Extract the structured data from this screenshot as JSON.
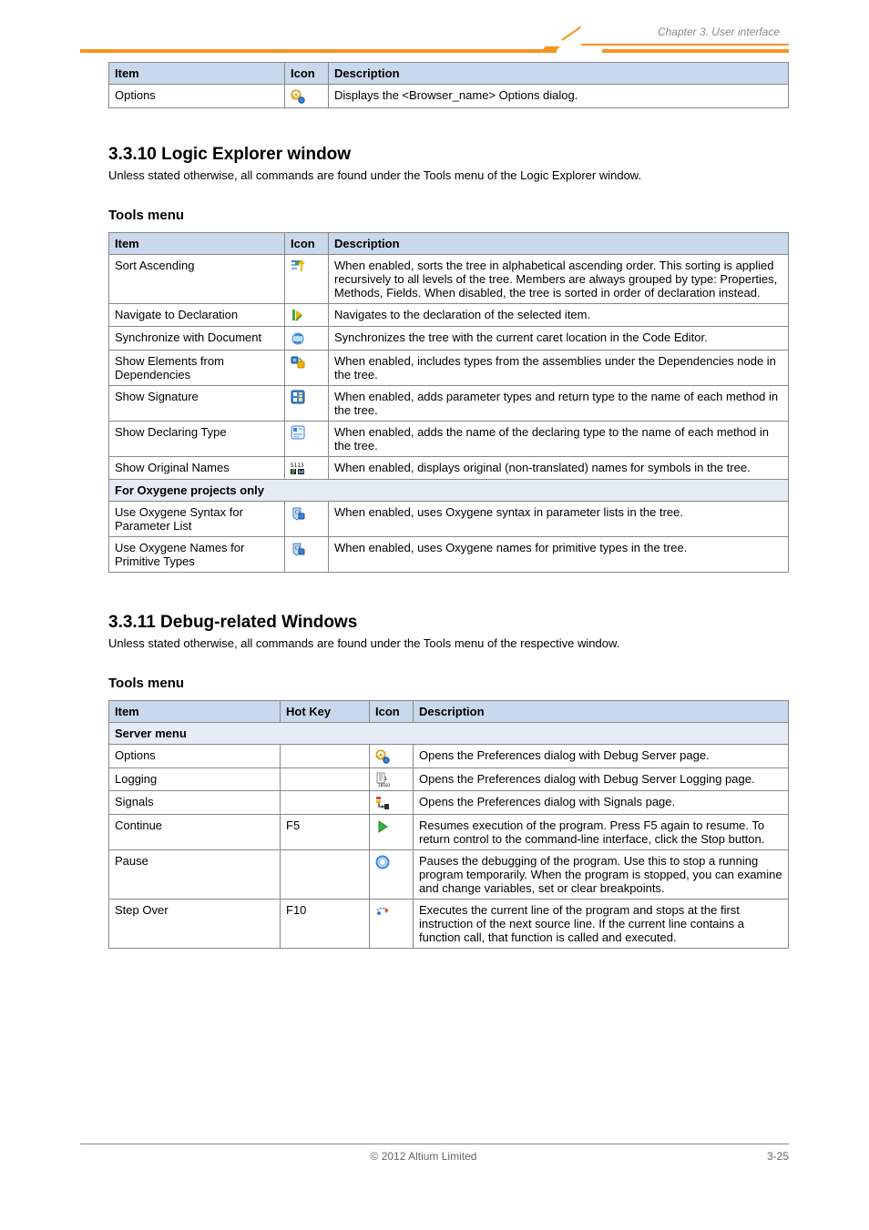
{
  "header_running": "Chapter 3. User interface",
  "footer": {
    "center": "© 2012 Altium Limited",
    "right": "3-25"
  },
  "table1": {
    "headers": [
      "Item",
      "Icon",
      "Description"
    ],
    "rows": [
      {
        "item": "Options",
        "icon": "options",
        "desc": "Displays the <Browser_name> Options dialog."
      }
    ]
  },
  "sections": {
    "logic_explorer": {
      "title": "3.3.10 Logic Explorer window",
      "sub": "Unless stated otherwise, all commands are found under the Tools menu of the Logic Explorer window.",
      "h2": "Tools menu"
    },
    "debug": {
      "title": "3.3.11 Debug-related Windows",
      "sub": "Unless stated otherwise, all commands are found under the Tools menu of the respective window.",
      "h2": "Tools menu"
    }
  },
  "table2": {
    "headers": [
      "Item",
      "Icon",
      "Description"
    ],
    "rows": [
      {
        "item": "Sort Ascending",
        "icon": "sort",
        "desc": "When enabled, sorts the tree in alphabetical ascending order. This sorting is applied recursively to all levels of the tree. Members are always grouped by type: Properties, Methods, Fields. When disabled, the tree is sorted in order of declaration instead."
      },
      {
        "item": "Navigate to Declaration",
        "icon": "nav-decl",
        "desc": "Navigates to the declaration of the selected item."
      },
      {
        "item": "Synchronize with Document",
        "icon": "sync",
        "desc": "Synchronizes the tree with the current caret location in the Code Editor."
      },
      {
        "item": "Show Elements from Dependencies",
        "icon": "deps",
        "desc": "When enabled, includes types from the assemblies under the Dependencies node in the tree."
      },
      {
        "item": "Show Signature",
        "icon": "sig",
        "desc": "When enabled, adds parameter types and return type to the name of each method in the tree."
      },
      {
        "item": "Show Declaring Type",
        "icon": "decl-type",
        "desc": "When enabled, adds the name of the declaring type to the name of each method in the tree."
      },
      {
        "item": "Show Original Names",
        "icon": "orig",
        "desc": "When enabled, displays original (non-translated) names for symbols in the tree."
      }
    ],
    "group": "For Oxygene projects only",
    "rows2": [
      {
        "item": "Use Oxygene Syntax for Parameter List",
        "icon": "oxy-param",
        "desc": "When enabled, uses Oxygene syntax in parameter lists in the tree."
      },
      {
        "item": "Use Oxygene Names for Primitive Types",
        "icon": "oxy-prim",
        "desc": "When enabled, uses Oxygene names for primitive types in the tree."
      }
    ]
  },
  "table3": {
    "headers": [
      "Item",
      "Hot Key",
      "Icon",
      "Description"
    ],
    "group": "Server menu",
    "rows": [
      {
        "item": "Options",
        "hotkey": "",
        "icon": "options",
        "desc": "Opens the Preferences dialog with Debug Server page."
      },
      {
        "item": "Logging",
        "hotkey": "",
        "icon": "logging",
        "desc": "Opens the Preferences dialog with Debug Server Logging page."
      },
      {
        "item": "Signals",
        "hotkey": "",
        "icon": "signals",
        "desc": "Opens the Preferences dialog with Signals page."
      },
      {
        "item": "Continue",
        "hotkey": "F5",
        "icon": "continue",
        "desc": "Resumes execution of the program. Press F5 again to resume. To return control to the command-line interface, click the Stop button."
      },
      {
        "item": "Pause",
        "hotkey": "",
        "icon": "pause",
        "desc": "Pauses the debugging of the program. Use this to stop a running program temporarily. When the program is stopped, you can examine and change variables, set or clear breakpoints."
      },
      {
        "item": "Step Over",
        "hotkey": "F10",
        "icon": "step-over",
        "desc": "Executes the current line of the program and stops at the first instruction of the next source line. If the current line contains a function call, that function is called and executed."
      }
    ]
  }
}
